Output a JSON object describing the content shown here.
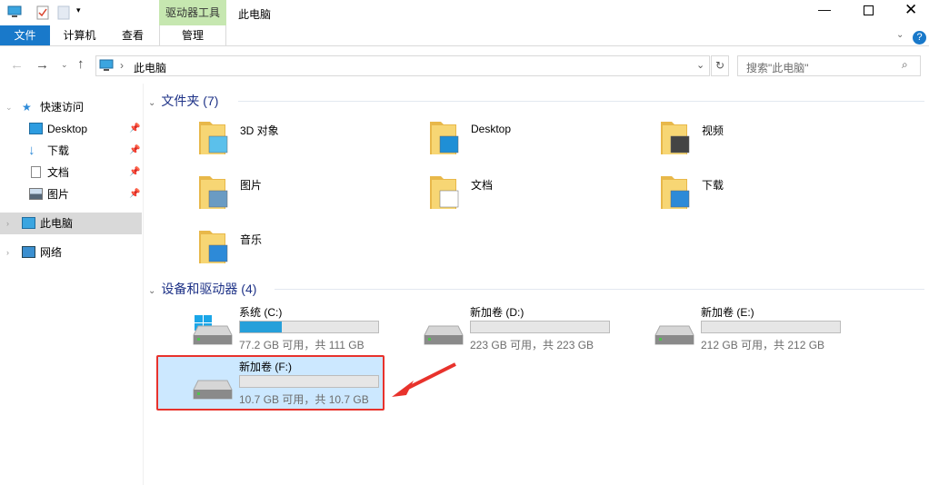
{
  "window": {
    "title": "此电脑",
    "context_group": "驱动器工具"
  },
  "ribbon": {
    "tabs": [
      "文件",
      "计算机",
      "查看"
    ],
    "context_tab": "管理"
  },
  "nav": {
    "path": "此电脑",
    "search_placeholder": "搜索\"此电脑\""
  },
  "sidebar": {
    "quick_access": "快速访问",
    "items": [
      {
        "label": "Desktop",
        "icon": "desktop-icon"
      },
      {
        "label": "下载",
        "icon": "download-icon"
      },
      {
        "label": "文档",
        "icon": "document-icon"
      },
      {
        "label": "图片",
        "icon": "picture-icon"
      }
    ],
    "this_pc": "此电脑",
    "network": "网络"
  },
  "folders_section": {
    "title": "文件夹 (7)",
    "items": [
      {
        "label": "3D 对象",
        "icon": "3d-objects-icon"
      },
      {
        "label": "Desktop",
        "icon": "desktop-folder-icon"
      },
      {
        "label": "视频",
        "icon": "video-folder-icon"
      },
      {
        "label": "图片",
        "icon": "pictures-folder-icon"
      },
      {
        "label": "文档",
        "icon": "documents-folder-icon"
      },
      {
        "label": "下载",
        "icon": "downloads-folder-icon"
      },
      {
        "label": "音乐",
        "icon": "music-folder-icon"
      }
    ]
  },
  "drives_section": {
    "title": "设备和驱动器 (4)",
    "items": [
      {
        "name": "系统 (C:)",
        "size": "77.2 GB 可用，共 111 GB",
        "used_fraction": 0.305
      },
      {
        "name": "新加卷 (D:)",
        "size": "223 GB 可用，共 223 GB",
        "used_fraction": 0
      },
      {
        "name": "新加卷 (E:)",
        "size": "212 GB 可用，共 212 GB",
        "used_fraction": 0
      },
      {
        "name": "新加卷 (F:)",
        "size": "10.7 GB 可用，共 10.7 GB",
        "used_fraction": 0
      }
    ]
  },
  "colors": {
    "accent": "#1979ca",
    "context": "#c6e7b0",
    "highlight": "#cce8ff",
    "annotation": "#e8322c"
  }
}
